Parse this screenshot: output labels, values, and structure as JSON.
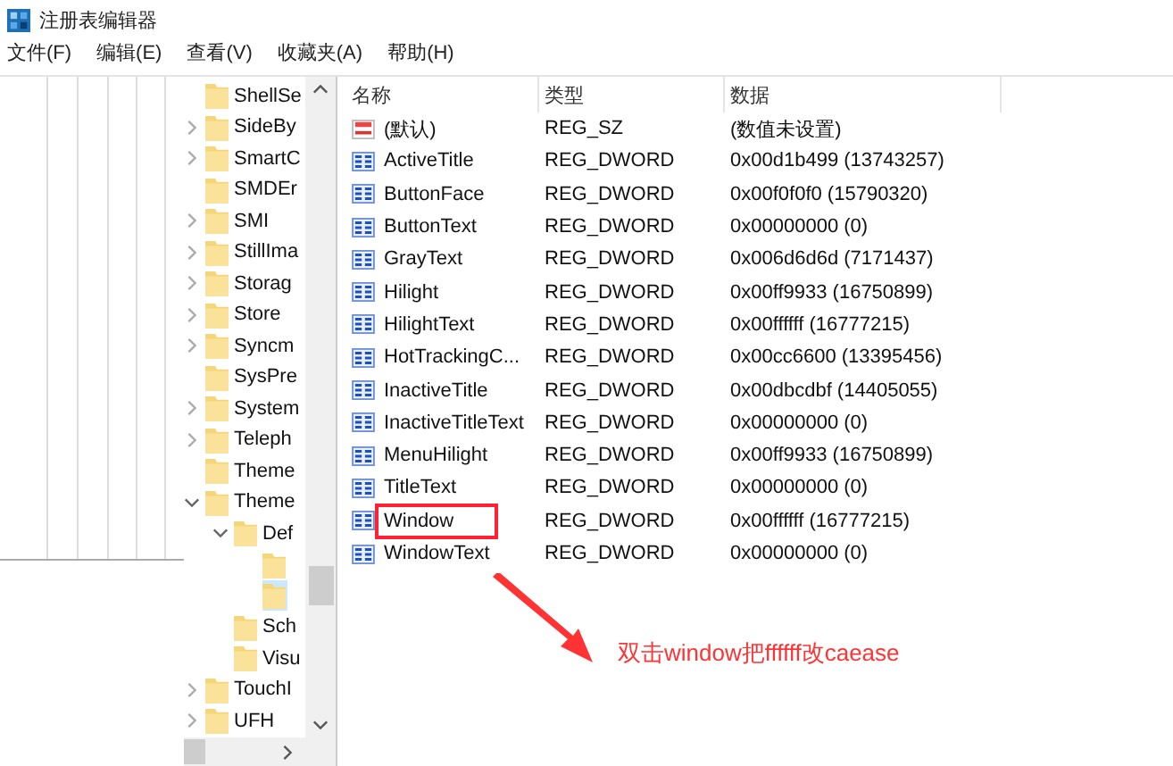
{
  "window": {
    "title": "注册表编辑器"
  },
  "menu": [
    "文件(F)",
    "编辑(E)",
    "查看(V)",
    "收藏夹(A)",
    "帮助(H)"
  ],
  "tree": [
    {
      "label": "ShellSe",
      "selected": false
    },
    {
      "label": "SideBy",
      "expanded": false,
      "selected": false
    },
    {
      "label": "SmartC",
      "expanded": false,
      "selected": false
    },
    {
      "label": "SMDEr",
      "selected": false
    },
    {
      "label": "SMI",
      "expanded": false,
      "selected": false
    },
    {
      "label": "StillIma",
      "expanded": false,
      "selected": false
    },
    {
      "label": "Storag",
      "expanded": false,
      "selected": false
    },
    {
      "label": "Store",
      "expanded": false,
      "selected": false
    },
    {
      "label": "Syncm",
      "expanded": false,
      "selected": false
    },
    {
      "label": "SysPre",
      "selected": false
    },
    {
      "label": "System",
      "expanded": false,
      "selected": false
    },
    {
      "label": "Teleph",
      "expanded": false,
      "selected": false
    },
    {
      "label": "Theme",
      "selected": false
    },
    {
      "label": "Theme",
      "expanded": true,
      "selected": false,
      "children": [
        {
          "label": "Def",
          "expanded": true,
          "selected": false,
          "children": [
            {
              "selected": false
            },
            {
              "selected": true
            }
          ]
        },
        {
          "label": "Sch",
          "selected": false
        },
        {
          "label": "Visu",
          "selected": false
        }
      ]
    },
    {
      "label": "TouchI",
      "expanded": false,
      "selected": false
    },
    {
      "label": "UFH",
      "expanded": false,
      "selected": false
    }
  ],
  "table": {
    "columns": [
      "名称",
      "类型",
      "数据"
    ],
    "rows": [
      {
        "kind": "string",
        "name": "(默认)",
        "type": "REG_SZ",
        "data": "(数值未设置)",
        "marked": false
      },
      {
        "kind": "dword",
        "name": "ActiveTitle",
        "type": "REG_DWORD",
        "data": "0x00d1b499 (13743257)",
        "marked": false
      },
      {
        "kind": "dword",
        "name": "ButtonFace",
        "type": "REG_DWORD",
        "data": "0x00f0f0f0 (15790320)",
        "marked": false
      },
      {
        "kind": "dword",
        "name": "ButtonText",
        "type": "REG_DWORD",
        "data": "0x00000000 (0)",
        "marked": false
      },
      {
        "kind": "dword",
        "name": "GrayText",
        "type": "REG_DWORD",
        "data": "0x006d6d6d (7171437)",
        "marked": false
      },
      {
        "kind": "dword",
        "name": "Hilight",
        "type": "REG_DWORD",
        "data": "0x00ff9933 (16750899)",
        "marked": false
      },
      {
        "kind": "dword",
        "name": "HilightText",
        "type": "REG_DWORD",
        "data": "0x00ffffff (16777215)",
        "marked": false
      },
      {
        "kind": "dword",
        "name": "HotTrackingC...",
        "type": "REG_DWORD",
        "data": "0x00cc6600 (13395456)",
        "marked": false
      },
      {
        "kind": "dword",
        "name": "InactiveTitle",
        "type": "REG_DWORD",
        "data": "0x00dbcdbf (14405055)",
        "marked": false
      },
      {
        "kind": "dword",
        "name": "InactiveTitleText",
        "type": "REG_DWORD",
        "data": "0x00000000 (0)",
        "marked": false
      },
      {
        "kind": "dword",
        "name": "MenuHilight",
        "type": "REG_DWORD",
        "data": "0x00ff9933 (16750899)",
        "marked": false
      },
      {
        "kind": "dword",
        "name": "TitleText",
        "type": "REG_DWORD",
        "data": "0x00000000 (0)",
        "marked": false
      },
      {
        "kind": "dword",
        "name": "Window",
        "type": "REG_DWORD",
        "data": "0x00ffffff (16777215)",
        "marked": true
      },
      {
        "kind": "dword",
        "name": "WindowText",
        "type": "REG_DWORD",
        "data": "0x00000000 (0)",
        "marked": false
      }
    ]
  },
  "annotation": {
    "text": "双击window把ffffff改caease"
  }
}
